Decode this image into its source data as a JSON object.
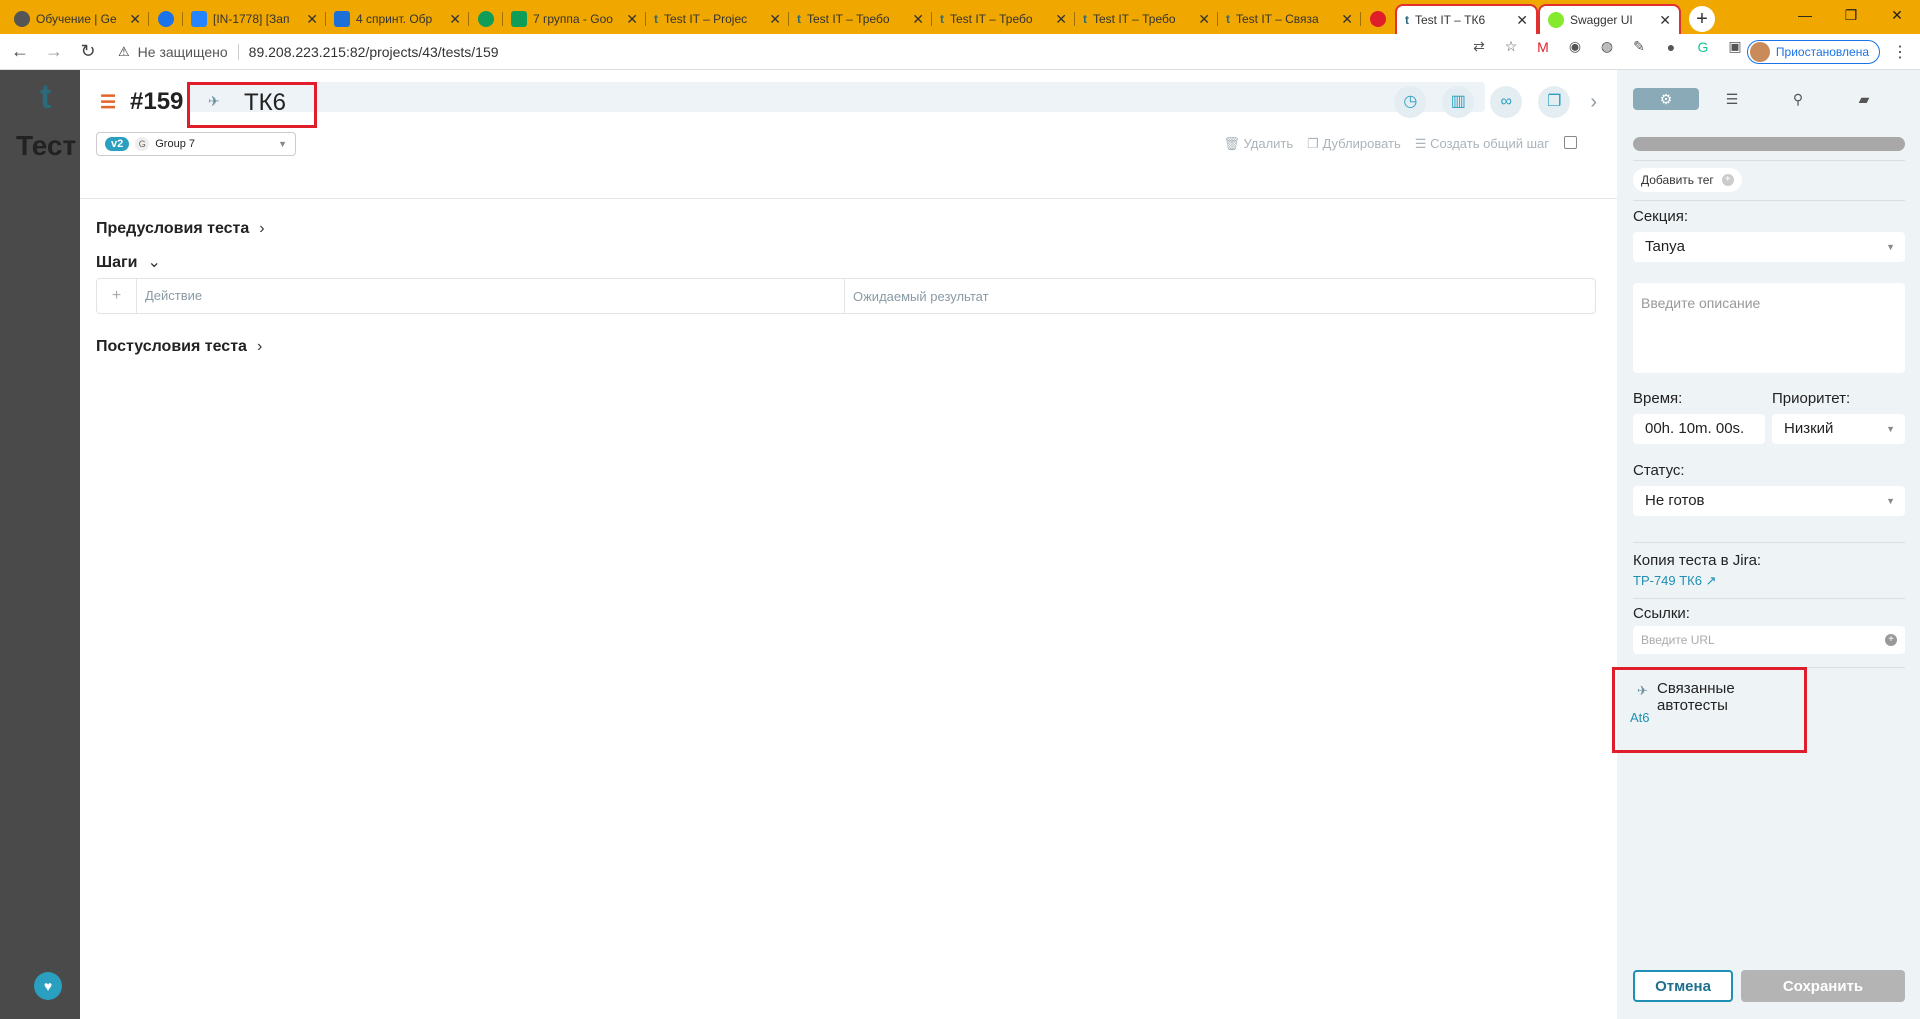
{
  "browser": {
    "tabs": [
      {
        "title": "Обучение | Ge",
        "color": "#333333"
      },
      {
        "title": "",
        "color": "#1a73e8"
      },
      {
        "title": "[IN-1778] [Зап",
        "color": "#2684ff"
      },
      {
        "title": "4 спринт. Обр",
        "color": "#1d6fd8"
      },
      {
        "title": "",
        "color": "#0f9d58"
      },
      {
        "title": "7 группа - Goo",
        "color": "#0f9d58"
      },
      {
        "title": "Test IT – Projec",
        "color": "#2a6a7a"
      },
      {
        "title": "Test IT – Требо",
        "color": "#2a6a7a"
      },
      {
        "title": "Test IT – Требо",
        "color": "#2a6a7a"
      },
      {
        "title": "Test IT – Требо",
        "color": "#2a6a7a"
      },
      {
        "title": "Test IT – Связа",
        "color": "#2a6a7a"
      },
      {
        "title": "",
        "color": "#e01e2b"
      },
      {
        "title": "Test IT – ТК6",
        "color": "#2a6a7a"
      },
      {
        "title": "Swagger UI",
        "color": "#85ea2d"
      }
    ],
    "insecure_label": "Не защищено",
    "url": "89.208.223.215:82/projects/43/tests/159",
    "profile_status": "Приостановлена"
  },
  "test": {
    "number": "#159",
    "name": "ТК6",
    "version_badge": "v2",
    "group_initial": "G",
    "group": "Group 7",
    "actions": {
      "delete": "Удалить",
      "duplicate": "Дублировать",
      "shared_step": "Создать общий шаг"
    },
    "preconditions": "Предусловия теста",
    "steps": "Шаги",
    "step_action_header": "Действие",
    "step_result_header": "Ожидаемый результат",
    "postconditions": "Постусловия теста"
  },
  "sidebar": {
    "add_tag": "Добавить тег",
    "section_label": "Секция:",
    "section_value": "Tanya",
    "description_placeholder": "Введите описание",
    "time_label": "Время:",
    "time_value": "00h. 10m. 00s.",
    "priority_label": "Приоритет:",
    "priority_value": "Низкий",
    "status_label": "Статус:",
    "status_value": "Не готов",
    "jira_label": "Копия теста в Jira:",
    "jira_link": "TP-749 ТК6",
    "links_label": "Ссылки:",
    "url_placeholder": "Введите URL",
    "autotests_label": "Связанные автотесты",
    "autotest_link": "At6",
    "cancel": "Отмена",
    "save": "Сохранить"
  },
  "background": {
    "logo": "t",
    "page_title": "Тест"
  }
}
